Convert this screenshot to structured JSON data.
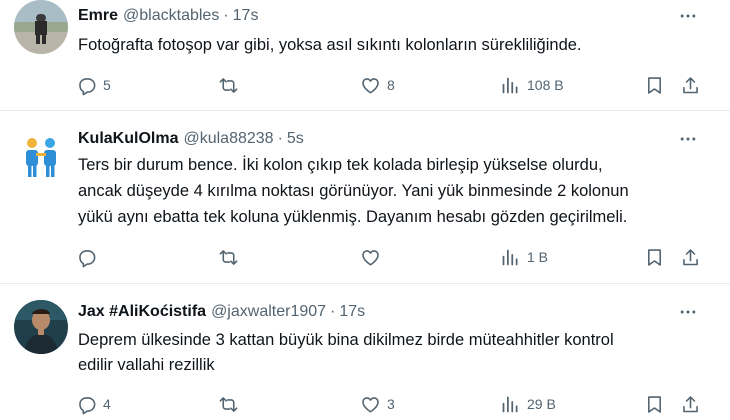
{
  "tweets": [
    {
      "name": "Emre",
      "handle": "@blacktables",
      "sep": "·",
      "time": "17s",
      "lines": [
        "Fotoğrafta fotoşop var gibi, yoksa asıl sıkıntı kolonların sürekliliğinde."
      ],
      "replies": "5",
      "retweets": "",
      "likes": "8",
      "views": "108 B"
    },
    {
      "name": "KulaKulOlma",
      "handle": "@kula88238",
      "sep": "·",
      "time": "5s",
      "lines": [
        "Ters bir durum bence. İki kolon çıkıp tek kolada birleşip yükselse olurdu,",
        "ancak düşeyde 4 kırılma noktası görünüyor. Yani yük binmesinde 2 kolonun",
        "yükü aynı ebatta tek koluna yüklenmiş. Dayanım hesabı gözden geçirilmeli."
      ],
      "replies": "",
      "retweets": "",
      "likes": "",
      "views": "1 B"
    },
    {
      "name": "Jax #AliKoćistifa",
      "handle": "@jaxwalter1907",
      "sep": "·",
      "time": "17s",
      "lines": [
        "Deprem ülkesinde 3 kattan büyük bina dikilmez birde müteahhitler kontrol",
        "edilir vallahi rezillik"
      ],
      "replies": "4",
      "retweets": "",
      "likes": "3",
      "views": "29 B"
    }
  ],
  "icons": {
    "reply": "reply-icon",
    "retweet": "retweet-icon",
    "like": "heart-icon",
    "views": "views-icon",
    "bookmark": "bookmark-icon",
    "share": "share-icon",
    "more": "more-icon"
  },
  "colors": {
    "text": "#0f1419",
    "secondary": "#536471",
    "divider": "#e8ecee"
  }
}
